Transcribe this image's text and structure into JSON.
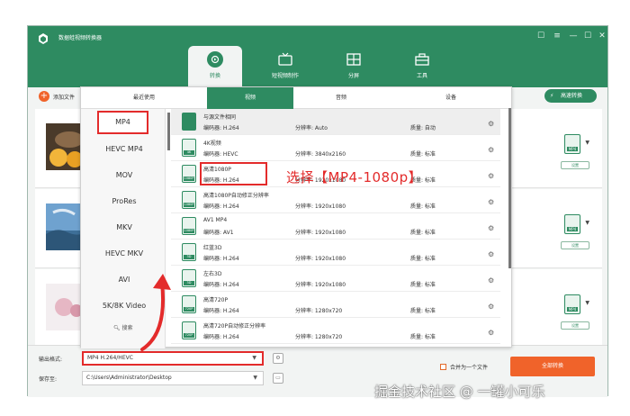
{
  "app": {
    "title": "数据蛙视频转换器",
    "window_controls": [
      "☐",
      "≡",
      "—",
      "☐",
      "✕"
    ]
  },
  "nav_tabs": [
    {
      "label": "转换",
      "icon": "convert-icon",
      "active": true
    },
    {
      "label": "短视频制作",
      "icon": "tv-icon",
      "active": false
    },
    {
      "label": "分屏",
      "icon": "split-screen-icon",
      "active": false
    },
    {
      "label": "工具",
      "icon": "toolbox-icon",
      "active": false
    }
  ],
  "toolbar": {
    "add_file_label": "添加文件",
    "hw_accel_label": "高速转换"
  },
  "files": [
    {
      "format_badge": "MP4",
      "settings_label": "设置"
    },
    {
      "format_badge": "MP4",
      "settings_label": "设置"
    },
    {
      "format_badge": "MP4",
      "settings_label": "设置"
    }
  ],
  "format_panel": {
    "tabs": [
      {
        "label": "最近使用",
        "active": false
      },
      {
        "label": "视频",
        "active": true
      },
      {
        "label": "音频",
        "active": false
      },
      {
        "label": "设备",
        "active": false
      }
    ],
    "formats": [
      "MP4",
      "HEVC MP4",
      "MOV",
      "ProRes",
      "MKV",
      "HEVC MKV",
      "AVI",
      "5K/8K Video"
    ],
    "selected_format": "MP4",
    "search_label": "搜索",
    "presets": [
      {
        "name": "与源文件相同",
        "badge": "",
        "codec": "编码器:   H.264",
        "resolution": "分辨率:   Auto",
        "quality": "质量:   自动"
      },
      {
        "name": "4K视频",
        "badge": "4K",
        "codec": "编码器:   HEVC",
        "resolution": "分辨率:   3840x2160",
        "quality": "质量:   标准"
      },
      {
        "name": "高清1080P",
        "badge": "1080P",
        "codec": "编码器:   H.264",
        "resolution": "分辨率:   1920x1080",
        "quality": "质量:   标准"
      },
      {
        "name": "高清1080P自动修正分辨率",
        "badge": "1080P",
        "codec": "编码器:   H.264",
        "resolution": "分辨率:   1920x1080",
        "quality": "质量:   标准"
      },
      {
        "name": "AV1 MP4",
        "badge": "1080P",
        "codec": "编码器:   AV1",
        "resolution": "分辨率:   1920x1080",
        "quality": "质量:   标准"
      },
      {
        "name": "红蓝3D",
        "badge": "3D",
        "codec": "编码器:   H.264",
        "resolution": "分辨率:   1920x1080",
        "quality": "质量:   标准"
      },
      {
        "name": "左右3D",
        "badge": "3D",
        "codec": "编码器:   H.264",
        "resolution": "分辨率:   1920x1080",
        "quality": "质量:   标准"
      },
      {
        "name": "高清720P",
        "badge": "720P",
        "codec": "编码器:   H.264",
        "resolution": "分辨率:   1280x720",
        "quality": "质量:   标准"
      },
      {
        "name": "高清720P自动修正分辨率",
        "badge": "720P",
        "codec": "编码器:   H.264",
        "resolution": "分辨率:   1280x720",
        "quality": "质量:   标准"
      }
    ]
  },
  "bottom_bar": {
    "output_format_label": "输出格式:",
    "output_format_value": "MP4 H.264/HEVC",
    "save_to_label": "保存至:",
    "save_to_value": "C:\\Users\\Administrator\\Desktop",
    "merge_label": "合并为一个文件",
    "convert_all_label": "全部转换"
  },
  "annotation": "选择【MP4-1080p】",
  "watermark": "掘金技术社区 @ 一罐小可乐",
  "colors": {
    "brand_green": "#2e8b61",
    "accent_orange": "#f0632a",
    "highlight_red": "#e32b2b"
  }
}
